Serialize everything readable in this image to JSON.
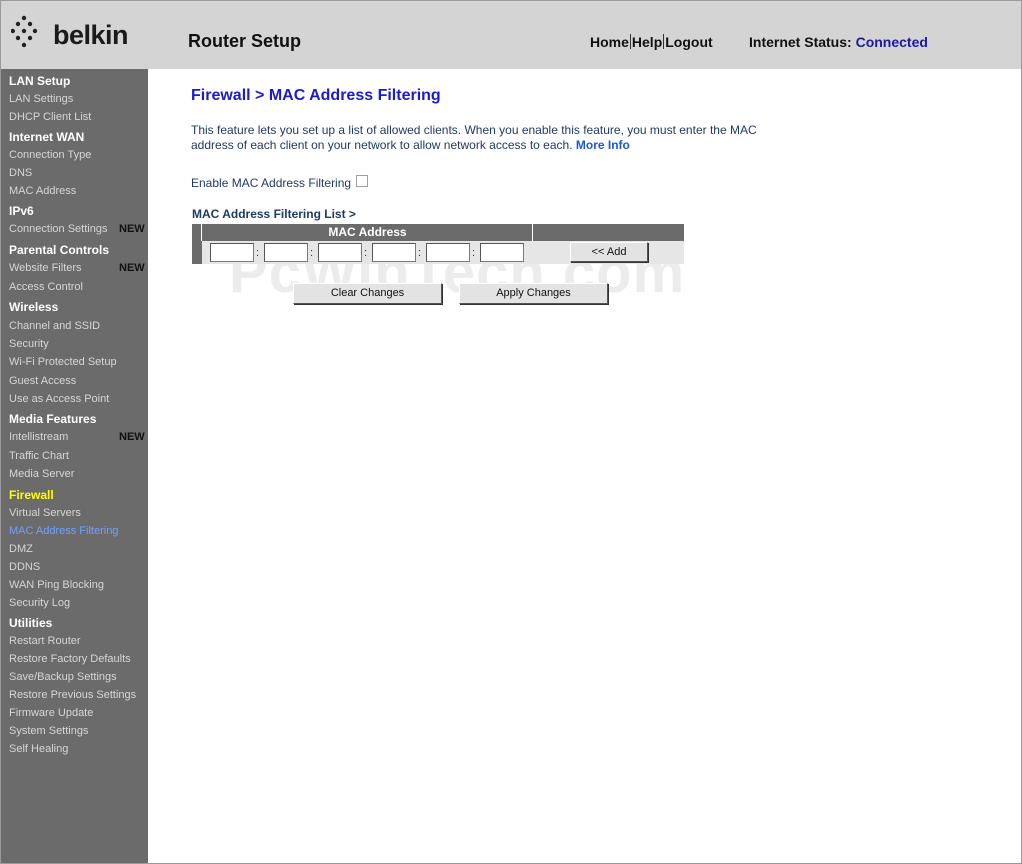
{
  "header": {
    "logo_text": "belkin",
    "title": "Router Setup",
    "nav": {
      "home": "Home",
      "help": "Help",
      "logout": "Logout"
    },
    "status_label": "Internet Status:",
    "status_value": "Connected"
  },
  "sidebar": {
    "lan_setup": "LAN Setup",
    "lan_settings": "LAN Settings",
    "dhcp_client_list": "DHCP Client List",
    "internet_wan": "Internet WAN",
    "connection_type": "Connection Type",
    "dns": "DNS",
    "mac_address": "MAC Address",
    "ipv6": "IPv6",
    "connection_settings": "Connection Settings",
    "parental_controls": "Parental Controls",
    "website_filters": "Website Filters",
    "access_control": "Access Control",
    "wireless": "Wireless",
    "channel_ssid": "Channel and SSID",
    "security": "Security",
    "wps": "Wi-Fi Protected Setup",
    "guest_access": "Guest Access",
    "access_point": "Use as Access Point",
    "media_features": "Media Features",
    "intellistream": "Intellistream",
    "traffic_chart": "Traffic Chart",
    "media_server": "Media Server",
    "firewall": "Firewall",
    "virtual_servers": "Virtual Servers",
    "mac_filtering": "MAC Address Filtering",
    "dmz": "DMZ",
    "ddns": "DDNS",
    "wan_ping": "WAN Ping Blocking",
    "security_log": "Security Log",
    "utilities": "Utilities",
    "restart_router": "Restart Router",
    "restore_factory": "Restore Factory Defaults",
    "save_backup": "Save/Backup Settings",
    "restore_previous": "Restore Previous Settings",
    "firmware_update": "Firmware Update",
    "system_settings": "System Settings",
    "self_healing": "Self Healing",
    "new_badge": "NEW"
  },
  "main": {
    "page_title": "Firewall > MAC Address Filtering",
    "description": "This feature lets you set up a list of allowed clients. When you enable this feature, you must enter the MAC address of each client on your network to allow network access to each.",
    "more_info": "More Info",
    "enable_label": "Enable MAC Address Filtering",
    "enable_checked": false,
    "list_title": "MAC Address Filtering List >",
    "table_header": "MAC Address",
    "mac_separator": ":",
    "add_button": "<< Add",
    "clear_button": "Clear Changes",
    "apply_button": "Apply Changes"
  },
  "watermark": "PcWinTech.com",
  "colors": {
    "header_bg": "#d4d4d4",
    "sidebar_bg": "#6b6b6b",
    "title_blue": "#1a1ad6",
    "status_blue": "#1a1aa6",
    "active_section": "#ffff00",
    "active_item": "#6fa0ff"
  }
}
